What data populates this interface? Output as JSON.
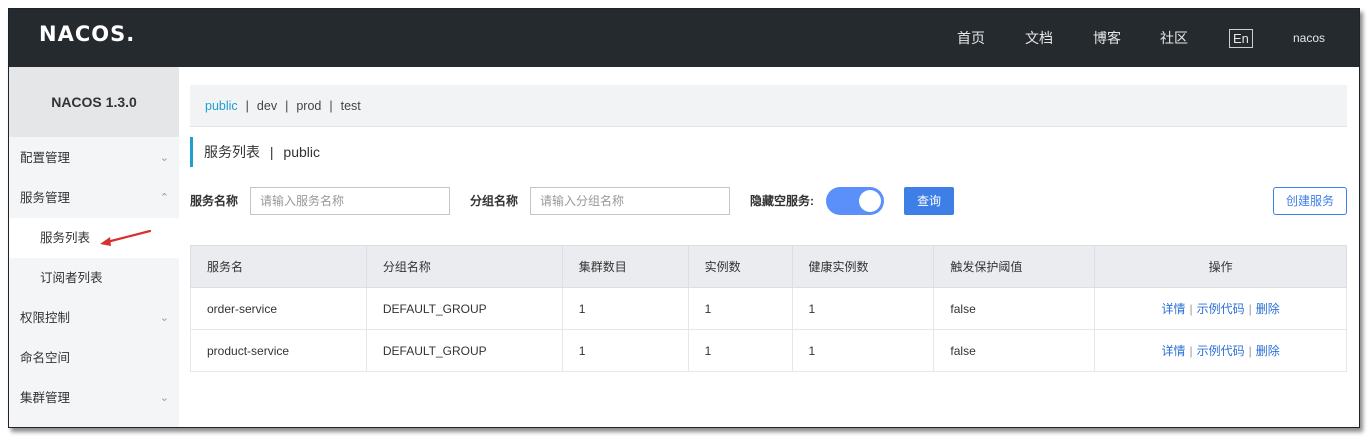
{
  "header": {
    "logo": "NACOS.",
    "nav": [
      "首页",
      "文档",
      "博客",
      "社区"
    ],
    "lang": "En",
    "user": "nacos"
  },
  "sidebar": {
    "version": "NACOS 1.3.0",
    "items": [
      {
        "label": "配置管理",
        "chevron": "⌄"
      },
      {
        "label": "服务管理",
        "chevron": "⌃"
      },
      {
        "label": "服务列表"
      },
      {
        "label": "订阅者列表"
      },
      {
        "label": "权限控制",
        "chevron": "⌄"
      },
      {
        "label": "命名空间"
      },
      {
        "label": "集群管理",
        "chevron": "⌄"
      }
    ]
  },
  "namespaces": [
    "public",
    "dev",
    "prod",
    "test"
  ],
  "page_title": {
    "main": "服务列表",
    "sep": "|",
    "ns": "public"
  },
  "filters": {
    "service_label": "服务名称",
    "service_placeholder": "请输入服务名称",
    "group_label": "分组名称",
    "group_placeholder": "请输入分组名称",
    "hide_empty_label": "隐藏空服务:",
    "query_btn": "查询",
    "create_btn": "创建服务"
  },
  "table": {
    "headers": [
      "服务名",
      "分组名称",
      "集群数目",
      "实例数",
      "健康实例数",
      "触发保护阈值",
      "操作"
    ],
    "rows": [
      [
        "order-service",
        "DEFAULT_GROUP",
        "1",
        "1",
        "1",
        "false"
      ],
      [
        "product-service",
        "DEFAULT_GROUP",
        "1",
        "1",
        "1",
        "false"
      ]
    ],
    "actions": [
      "详情",
      "示例代码",
      "删除"
    ],
    "action_sep": "|"
  },
  "colors": {
    "topbar": "#252a2f",
    "accent": "#1e9fcf",
    "primary": "#3d7fe6",
    "arrow": "#d9302f"
  }
}
